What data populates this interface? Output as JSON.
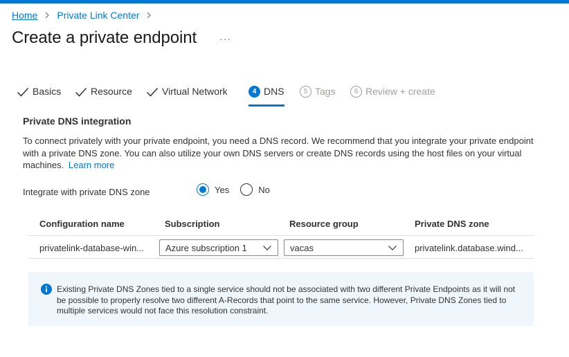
{
  "breadcrumb": {
    "home": "Home",
    "private_link_center": "Private Link Center"
  },
  "page": {
    "title": "Create a private endpoint",
    "more": "···"
  },
  "tabs": [
    {
      "label": "Basics",
      "state": "done"
    },
    {
      "label": "Resource",
      "state": "done"
    },
    {
      "label": "Virtual Network",
      "state": "done"
    },
    {
      "label": "DNS",
      "number": "4",
      "state": "active"
    },
    {
      "label": "Tags",
      "number": "5",
      "state": "disabled"
    },
    {
      "label": "Review + create",
      "number": "6",
      "state": "disabled"
    }
  ],
  "dns": {
    "section_title": "Private DNS integration",
    "description": "To connect privately with your private endpoint, you need a DNS record. We recommend that you integrate your private endpoint with a private DNS zone. You can also utilize your own DNS servers or create DNS records using the host files on your virtual machines.",
    "learn_more": "Learn more",
    "integrate_label": "Integrate with private DNS zone",
    "radio_yes": "Yes",
    "radio_no": "No",
    "selected": "Yes"
  },
  "table": {
    "headers": {
      "configuration_name": "Configuration name",
      "subscription": "Subscription",
      "resource_group": "Resource group",
      "private_dns_zone": "Private DNS zone"
    },
    "rows": [
      {
        "configuration_name": "privatelink-database-win...",
        "subscription": "Azure subscription 1",
        "resource_group": "vacas",
        "private_dns_zone": "privatelink.database.wind..."
      }
    ]
  },
  "info": {
    "text": "Existing Private DNS Zones tied to a single service should not be associated with two different Private Endpoints as it will not be possible to properly resolve two different A-Records that point to the same service. However, Private DNS Zones tied to multiple services would not face this resolution constraint."
  },
  "colors": {
    "accent": "#0078d4",
    "info_background": "#eff6fc",
    "disabled_text": "#a19f9d"
  },
  "icons": {
    "tab_done": "checkmark-icon",
    "dropdown": "chevron-down-icon",
    "breadcrumb_separator": "chevron-right-icon",
    "info": "info-icon"
  }
}
